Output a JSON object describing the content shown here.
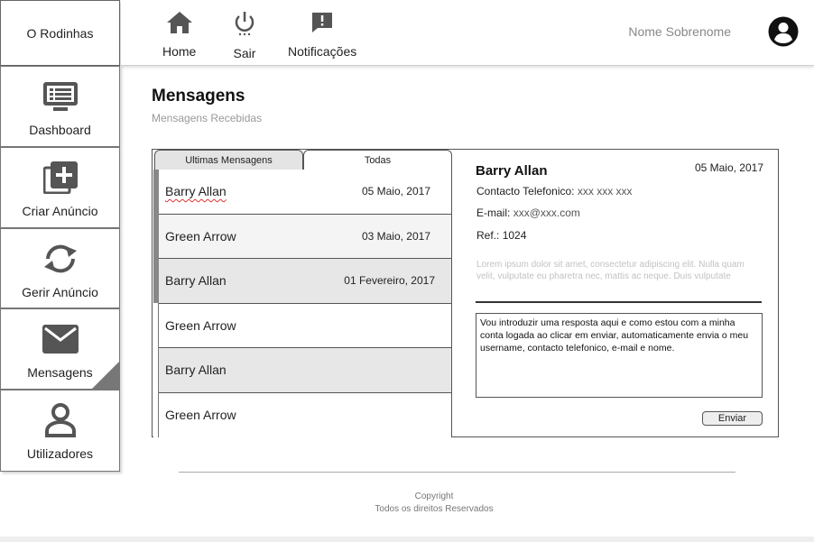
{
  "brand": "O Rodinhas",
  "sidebar": {
    "items": [
      {
        "label": "Dashboard",
        "icon": "dashboard-icon"
      },
      {
        "label": "Criar Anúncio",
        "icon": "add-box-icon"
      },
      {
        "label": "Gerir Anúncio",
        "icon": "sync-icon"
      },
      {
        "label": "Mensagens",
        "icon": "mail-icon",
        "active": true
      },
      {
        "label": "Utilizadores",
        "icon": "user-icon"
      }
    ]
  },
  "topbar": {
    "links": [
      {
        "label": "Home",
        "icon": "home-icon"
      },
      {
        "label": "Sair",
        "icon": "power-icon"
      },
      {
        "label": "Notificações",
        "icon": "notification-icon"
      }
    ],
    "user_name": "Nome Sobrenome"
  },
  "page": {
    "title": "Mensagens",
    "subtitle": "Mensagens Recebidas"
  },
  "tabs": [
    {
      "label": "Ultimas Mensagens",
      "active": true
    },
    {
      "label": "Todas",
      "active": false
    }
  ],
  "messages": [
    {
      "name": "Barry Allan",
      "date": "05 Maio, 2017"
    },
    {
      "name": "Green Arrow",
      "date": "03 Maio, 2017"
    },
    {
      "name": "Barry Allan",
      "date": "01 Fevereiro, 2017"
    },
    {
      "name": "Green Arrow",
      "date": ""
    },
    {
      "name": "Barry Allan",
      "date": ""
    },
    {
      "name": "Green Arrow",
      "date": ""
    }
  ],
  "detail": {
    "name": "Barry Allan",
    "date": "05 Maio, 2017",
    "phone_label": "Contacto Telefonico:",
    "phone_value": "xxx xxx xxx",
    "email_label": "E-mail:",
    "email_value": "xxx@xxx.com",
    "ref_label": "Ref.:",
    "ref_value": "1024",
    "lorem": "Lorem ipsum dolor sit amet, consectetur adipiscing elit. Nulla quam velit, vulputate eu pharetra nec, mattis ac neque. Duis vulputate",
    "reply_text": "Vou introduzir uma resposta aqui e como estou com a minha conta logada ao clicar em enviar, automaticamente envia o meu username, contacto telefonico, e-mail e nome.",
    "send_label": "Enviar"
  },
  "footer": {
    "line1": "Copyright",
    "line2": "Todos os direitos Reservados"
  },
  "colors": {
    "icon": "#555555",
    "row_shade": "#e7e7e7",
    "lorem": "#c2c2c2"
  }
}
